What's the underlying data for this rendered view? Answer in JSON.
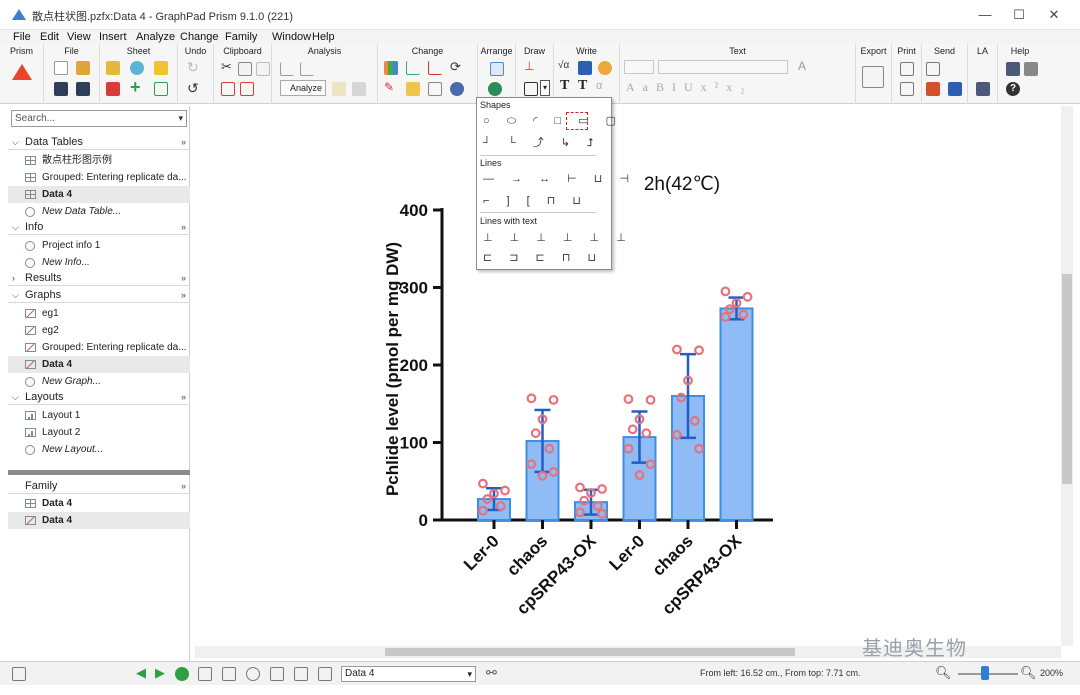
{
  "window": {
    "title": "散点柱状图.pzfx:Data 4 - GraphPad Prism 9.1.0 (221)"
  },
  "menu": [
    "File",
    "Edit",
    "View",
    "Insert",
    "Analyze",
    "Change",
    "Family",
    "Window",
    "Help"
  ],
  "ribbon": {
    "groups": [
      "Prism",
      "File",
      "Sheet",
      "Undo",
      "Clipboard",
      "Analysis",
      "Change",
      "Arrange",
      "Draw",
      "Write",
      "Text",
      "Export",
      "Print",
      "Send",
      "LA",
      "Help"
    ],
    "analyze_label": "Analyze"
  },
  "navigator": {
    "search_placeholder": "Search...",
    "sections": [
      {
        "label": "Data Tables",
        "items": [
          {
            "label": "散点柱形图示例",
            "icon": "table-icon"
          },
          {
            "label": "Grouped: Entering replicate da...",
            "icon": "table-icon"
          },
          {
            "label": "Data 4",
            "icon": "table-icon",
            "selected": true
          },
          {
            "label": "New Data Table...",
            "icon": "plus-icon",
            "new": true
          }
        ]
      },
      {
        "label": "Info",
        "items": [
          {
            "label": "Project info 1",
            "icon": "info-icon"
          },
          {
            "label": "New Info...",
            "icon": "plus-icon",
            "new": true
          }
        ]
      },
      {
        "label": "Results",
        "items": []
      },
      {
        "label": "Graphs",
        "items": [
          {
            "label": "eg1",
            "icon": "graph-icon"
          },
          {
            "label": "eg2",
            "icon": "graph-icon"
          },
          {
            "label": "Grouped: Entering replicate da...",
            "icon": "graph-icon"
          },
          {
            "label": "Data 4",
            "icon": "graph-icon",
            "selected": true
          },
          {
            "label": "New Graph...",
            "icon": "plus-icon",
            "new": true
          }
        ]
      },
      {
        "label": "Layouts",
        "items": [
          {
            "label": "Layout 1",
            "icon": "layout-icon"
          },
          {
            "label": "Layout 2",
            "icon": "layout-icon"
          },
          {
            "label": "New Layout...",
            "icon": "plus-icon",
            "new": true
          }
        ]
      }
    ],
    "family": {
      "label": "Family",
      "items": [
        {
          "label": "Data 4",
          "icon": "table-icon"
        },
        {
          "label": "Data 4",
          "icon": "graph-icon",
          "selected": true
        }
      ]
    }
  },
  "shapes_popup": {
    "headers": [
      "Shapes",
      "Lines",
      "Lines with text"
    ],
    "rows": [
      "○ ⬭ ◜ □ ▭ ▢",
      "┘ └ ⤴ ↳ ⮥",
      "— → ↔ ⊢ ⊔ ⊣",
      "⌐ ] [ ⊓ ⊔",
      "⊥ ⊥ ⊥ ⊥ ⊥ ⊥",
      "⊏ ⊐ ⊏ ⊓ ⊔"
    ]
  },
  "chart_data": {
    "type": "bar",
    "title": "2h(42℃)",
    "ylabel": "Pchlide level (pmol per mg DW)",
    "xlabel": "",
    "ylim": [
      0,
      400
    ],
    "yticks": [
      0,
      100,
      200,
      300,
      400
    ],
    "categories": [
      "Ler-0",
      "chaos",
      "cpSRP43-OX",
      "Ler-0",
      "chaos",
      "cpSRP43-OX"
    ],
    "values": [
      27,
      102,
      23,
      107,
      160,
      273
    ],
    "errors": [
      14,
      40,
      16,
      33,
      54,
      14
    ],
    "points": [
      [
        47,
        38,
        34,
        27,
        18,
        12
      ],
      [
        157,
        155,
        130,
        112,
        92,
        72,
        62,
        57
      ],
      [
        42,
        40,
        35,
        25,
        18,
        10,
        8
      ],
      [
        156,
        155,
        130,
        117,
        112,
        92,
        72,
        58
      ],
      [
        220,
        219,
        180,
        158,
        128,
        110,
        92
      ],
      [
        295,
        288,
        280,
        272,
        265,
        262
      ]
    ],
    "bar_color": "#8fbcf5",
    "bar_edge": "#3d8ee6",
    "error_color": "#1f5fc9",
    "point_color": "#e8717a",
    "grid": false
  },
  "status": {
    "sheet": "Data 4",
    "position": "From left: 16.52 cm., From top: 7.71 cm.",
    "zoom": "200%"
  },
  "watermark": "基迪奥生物"
}
